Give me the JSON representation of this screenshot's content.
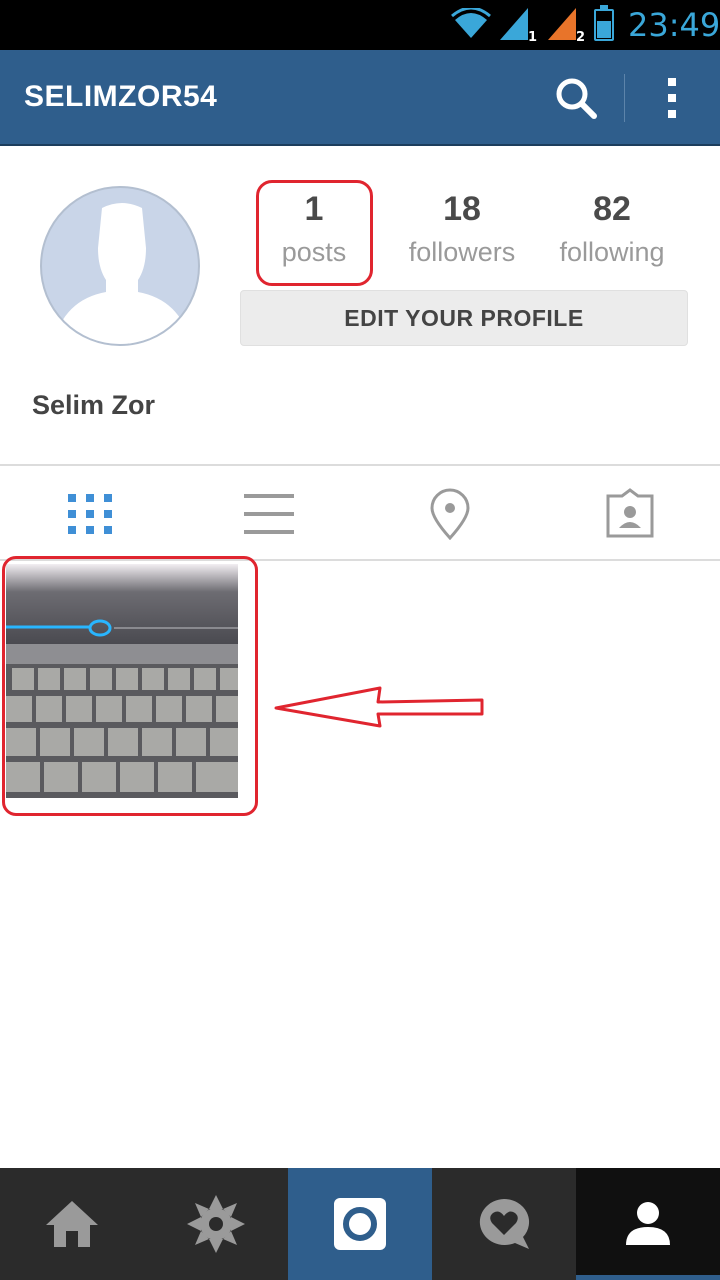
{
  "status_bar": {
    "time": "23:49",
    "sim1": "1",
    "sim2": "2"
  },
  "header": {
    "username": "SELIMZOR54",
    "search_icon": "search-icon",
    "menu_icon": "more-vert-icon"
  },
  "profile": {
    "avatar_icon": "default-avatar-icon",
    "full_name": "Selim Zor",
    "stats": {
      "posts": {
        "value": "1",
        "label": "posts"
      },
      "followers": {
        "value": "18",
        "label": "followers"
      },
      "following": {
        "value": "82",
        "label": "following"
      }
    },
    "edit_button": "EDIT YOUR PROFILE"
  },
  "tabs": [
    {
      "icon": "grid-icon",
      "active": true
    },
    {
      "icon": "list-icon",
      "active": false
    },
    {
      "icon": "location-pin-icon",
      "active": false
    },
    {
      "icon": "tagged-photos-icon",
      "active": false
    }
  ],
  "posts": [
    {
      "subject": "laptop keyboard photo"
    }
  ],
  "annotations": {
    "highlight_color": "#e0252f"
  },
  "bottom_nav": [
    {
      "icon": "home-icon"
    },
    {
      "icon": "explore-icon"
    },
    {
      "icon": "camera-icon"
    },
    {
      "icon": "activity-icon"
    },
    {
      "icon": "profile-icon",
      "active": true
    }
  ],
  "colors": {
    "brand": "#2f5e8c",
    "status_accent": "#3aa7d9",
    "tab_active": "#3f8fd6",
    "tab_inactive": "#9a9a9a"
  }
}
